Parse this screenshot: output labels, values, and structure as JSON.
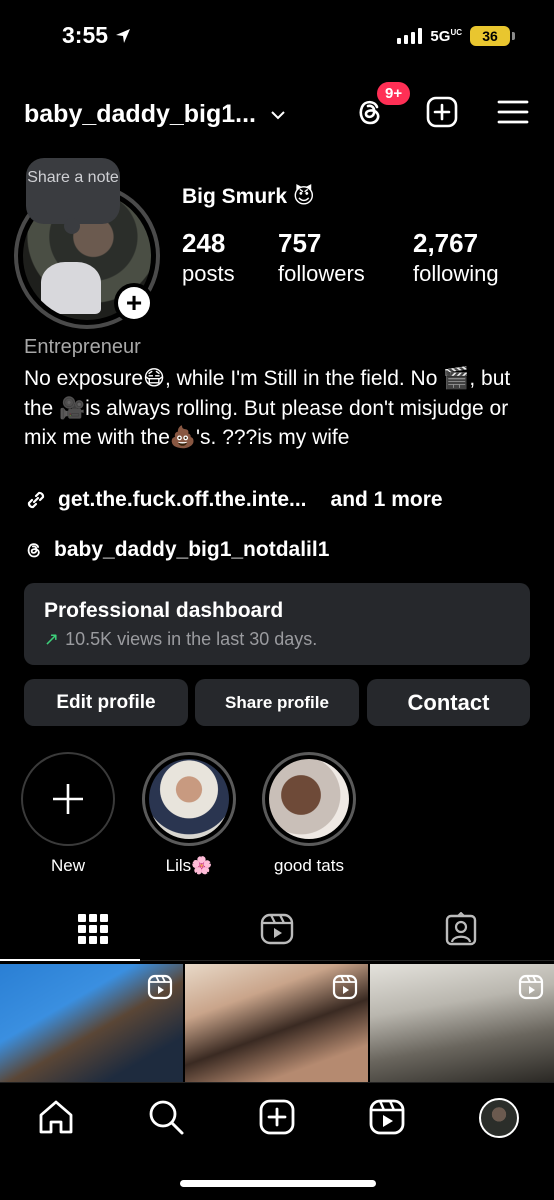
{
  "status_bar": {
    "time": "3:55",
    "network": "5G",
    "network_suffix": "UC",
    "battery": "36"
  },
  "header": {
    "username": "baby_daddy_big1...",
    "threads_badge": "9+"
  },
  "profile": {
    "note_label": "Share a note",
    "display_name": "Big Smurk 😈",
    "stats": [
      {
        "number": "248",
        "label": "posts"
      },
      {
        "number": "757",
        "label": "followers"
      },
      {
        "number": "2,767",
        "label": "following"
      }
    ],
    "category": "Entrepreneur",
    "bio": "No exposure😷, while I'm Still in the field. No 🎬, but the 🎥is always rolling. But please don't misjudge or mix me with the💩's. ???is my wife",
    "link_text": "get.the.fuck.off.the.inte...",
    "link_more": "and 1 more",
    "threads_handle": "baby_daddy_big1_notdalil1"
  },
  "dashboard": {
    "title": "Professional dashboard",
    "subtitle": "10.5K views in the last 30 days."
  },
  "buttons": {
    "edit": "Edit profile",
    "share": "Share profile",
    "contact": "Contact"
  },
  "highlights": [
    {
      "label": "New"
    },
    {
      "label": "Lils🌸"
    },
    {
      "label": "good tats"
    }
  ],
  "colors": {
    "background": "#000000",
    "surface": "#26282c",
    "badge": "#ff2f55",
    "accent_green": "#3dcf7a"
  }
}
